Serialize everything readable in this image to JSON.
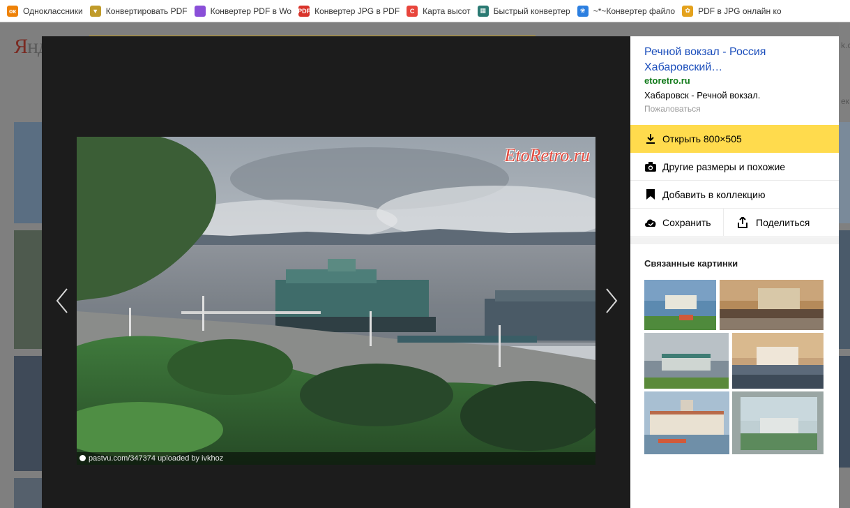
{
  "bookmarks": [
    {
      "label": "Одноклассники",
      "icon": "odnoklassniki-icon",
      "color": "#ee8208",
      "glyph": "ок"
    },
    {
      "label": "Конвертировать PDF",
      "icon": "pdf-converter-icon",
      "color": "#c09b2a",
      "glyph": "▼"
    },
    {
      "label": "Конвертер PDF в Wo",
      "icon": "colorful-square-icon",
      "color": "#8a4fd8",
      "glyph": ""
    },
    {
      "label": "Конвертер JPG в PDF",
      "icon": "pdf-icon",
      "color": "#d9342b",
      "glyph": "PDF"
    },
    {
      "label": "Карта высот",
      "icon": "map-c-icon",
      "color": "#e8453c",
      "glyph": "C"
    },
    {
      "label": "Быстрый конвертер",
      "icon": "converter-icon",
      "color": "#2b7a73",
      "glyph": "▦"
    },
    {
      "label": "~*~Конвертер файло",
      "icon": "flower-icon",
      "color": "#2c7fe0",
      "glyph": "❀"
    },
    {
      "label": "PDF в JPG онлайн ко",
      "icon": "pdf-jpg-icon",
      "color": "#e4a21d",
      "glyph": "✿"
    }
  ],
  "page": {
    "logo_first": "Я",
    "logo_rest": "нд",
    "right_text_1": "k.c",
    "right_text_2": "ек"
  },
  "viewer": {
    "watermark": "EtoRetro.ru",
    "credit": "pastvu.com/347374  uploaded by ivkhoz"
  },
  "panel": {
    "title": "Речной вокзал - Россия Хабаровский…",
    "domain": "etoretro.ru",
    "description": "Хабаровск - Речной вокзал.",
    "report": "Пожаловаться",
    "open_label": "Открыть  800×505",
    "other_sizes": "Другие размеры и похожие",
    "add_collection": "Добавить в коллекцию",
    "save": "Сохранить",
    "share": "Поделиться",
    "related_title": "Связанные картинки"
  },
  "colors": {
    "accent_yellow": "#ffdb4d",
    "title_link": "#1a4dbb",
    "domain_green": "#117a1a"
  }
}
